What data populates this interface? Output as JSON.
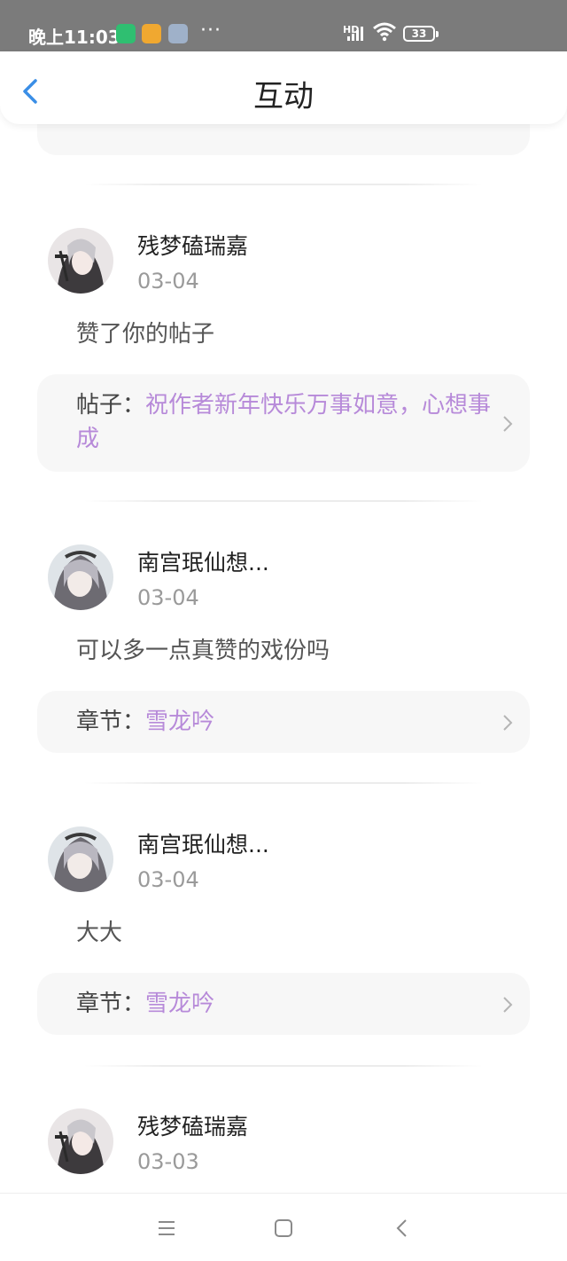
{
  "status_bar": {
    "time": "晚上11:03",
    "dots": "···",
    "signal_label": "HD",
    "battery": "33"
  },
  "header": {
    "title": "互动",
    "back_icon": "back-chevron-icon"
  },
  "items": [
    {
      "user": "残梦磕瑞嘉",
      "date": "03-04",
      "message": "赞了你的帖子",
      "ref_label": "帖子：",
      "ref_title": "祝作者新年快乐万事如意，心想事成"
    },
    {
      "user": "南宫珉仙想...",
      "date": "03-04",
      "message": "可以多一点真赞的戏份吗",
      "ref_label": "章节：",
      "ref_title": "雪龙吟"
    },
    {
      "user": "南宫珉仙想...",
      "date": "03-04",
      "message": "大大",
      "ref_label": "章节：",
      "ref_title": "雪龙吟"
    },
    {
      "user": "残梦磕瑞嘉",
      "date": "03-03"
    }
  ],
  "colors": {
    "accent_link": "#b78ad9",
    "back_icon": "#3a8ee6"
  },
  "bottom_nav": [
    "menu-icon",
    "home-square-icon",
    "back-icon"
  ]
}
